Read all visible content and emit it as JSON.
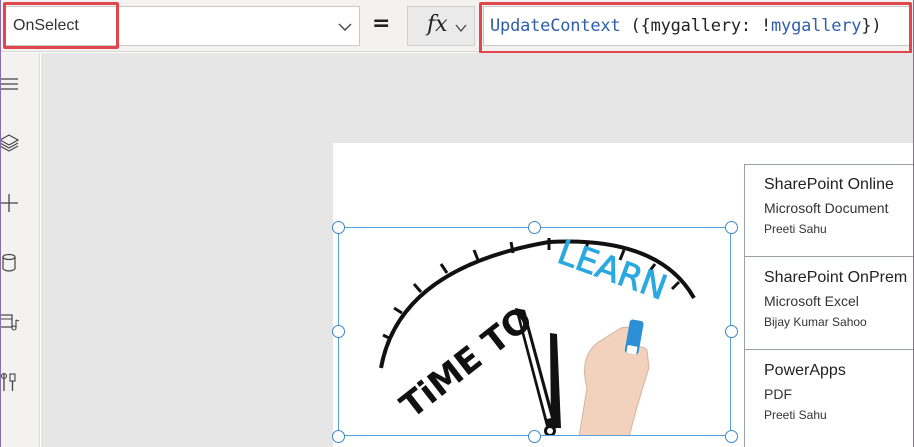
{
  "formula_bar": {
    "property": "OnSelect",
    "equals": "=",
    "fx_label": "fx",
    "formula_fn": "UpdateContext",
    "formula_mid": " ({mygallery: !",
    "formula_var": "mygallery",
    "formula_end": "})"
  },
  "left_rail": {
    "icons": [
      "menu-icon",
      "layers-icon",
      "plus-icon",
      "database-icon",
      "media-icon",
      "tools-icon"
    ]
  },
  "image": {
    "text_time_to": "TiME TO",
    "text_learn": "LEARN"
  },
  "gallery": {
    "items": [
      {
        "title": "SharePoint Online",
        "subtitle": "Microsoft Document",
        "author": "Preeti Sahu"
      },
      {
        "title": "SharePoint OnPrem",
        "subtitle": "Microsoft Excel",
        "author": "Bijay Kumar Sahoo"
      },
      {
        "title": "PowerApps",
        "subtitle": "PDF",
        "author": "Preeti Sahu"
      }
    ]
  },
  "colors": {
    "highlight": "#e0474c",
    "selection": "#3c87c9",
    "code_blue": "#2f5fa8"
  }
}
